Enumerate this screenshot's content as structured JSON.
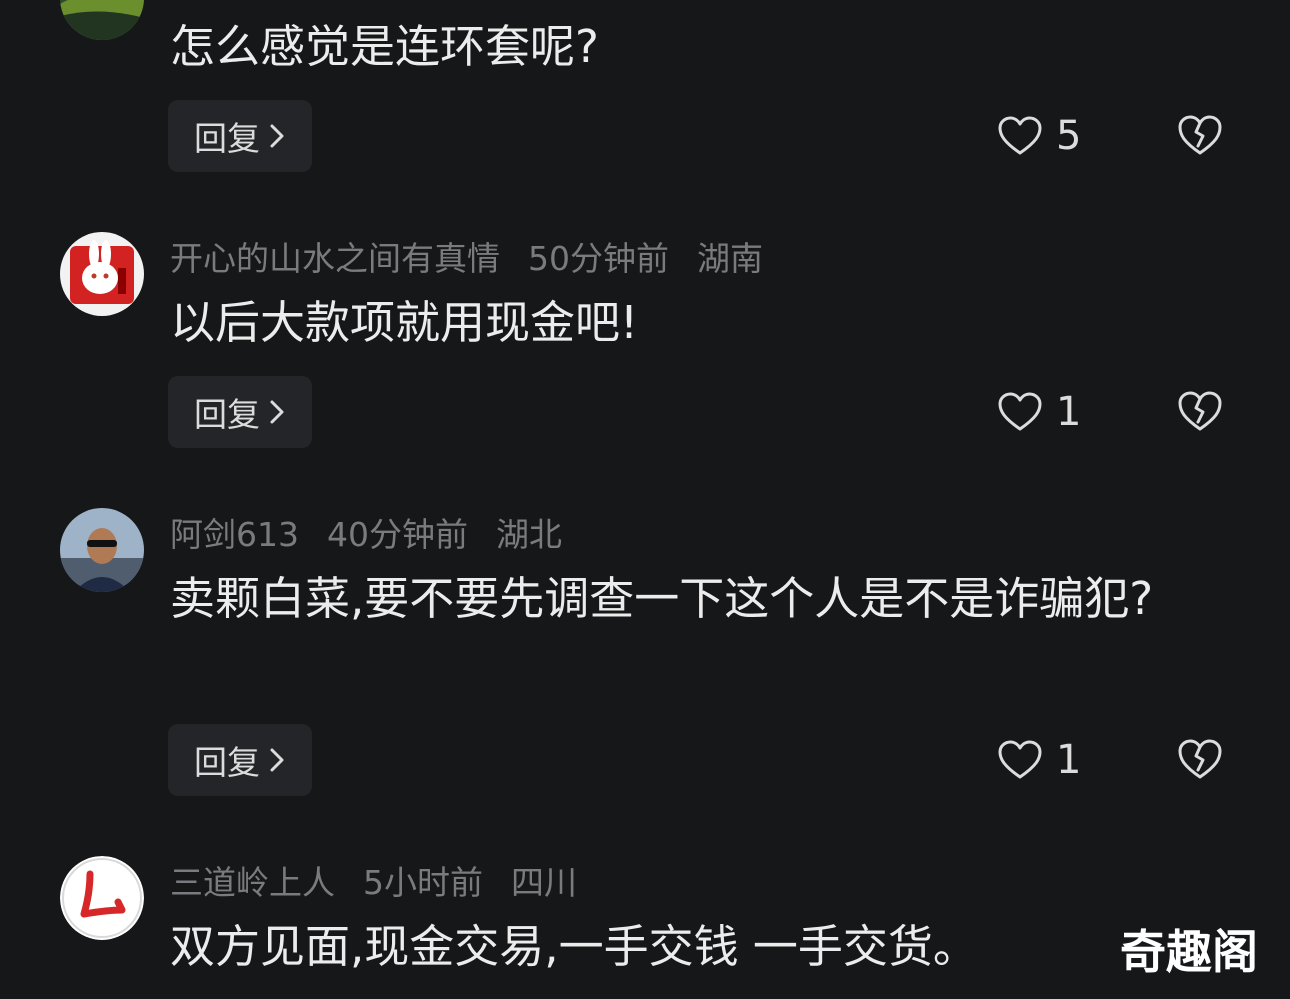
{
  "colors": {
    "background": "#161719",
    "meta_text": "#7a7b7e",
    "comment_text": "#ececec",
    "button_bg": "#242528"
  },
  "comments": [
    {
      "avatar": "landscape-avatar",
      "username": "",
      "time": "",
      "location": "",
      "text": "怎么感觉是连环套呢?",
      "reply_label": "回复",
      "like_count": "5"
    },
    {
      "avatar": "rabbit-avatar",
      "username": "开心的山水之间有真情",
      "time": "50分钟前",
      "location": "湖南",
      "text": "以后大款项就用现金吧!",
      "reply_label": "回复",
      "like_count": "1"
    },
    {
      "avatar": "man-sunglasses-avatar",
      "username": "阿剑613",
      "time": "40分钟前",
      "location": "湖北",
      "text": "卖颗白菜,要不要先调查一下这个人是不是诈骗犯?",
      "reply_label": "回复",
      "like_count": "1"
    },
    {
      "avatar": "red-calligraphy-avatar",
      "username": "三道岭上人",
      "time": "5小时前",
      "location": "四川",
      "text": "双方见面,现金交易,一手交钱 一手交货。"
    }
  ],
  "watermark": "奇趣阁"
}
